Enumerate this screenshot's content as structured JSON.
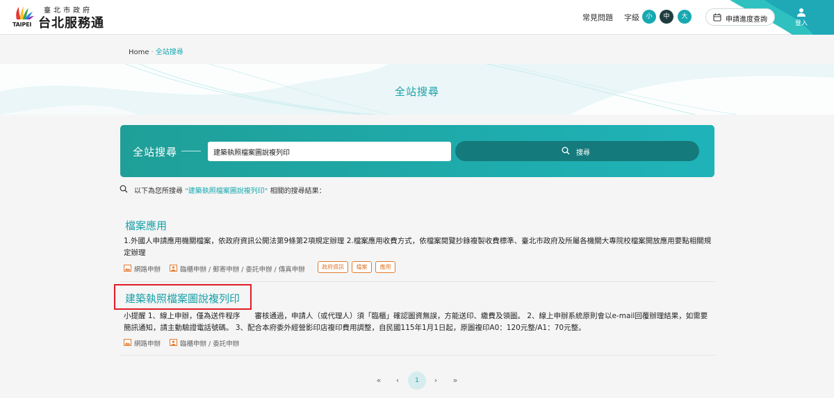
{
  "header": {
    "logo": {
      "gov_label": "臺北市政府",
      "app_name": "台北服務通",
      "city_label": "TAIPEI"
    },
    "faq_label": "常見問題",
    "font_size_label": "字級",
    "font_sizes": [
      "小",
      "中",
      "大"
    ],
    "progress_button_label": "申請進度查詢",
    "login_label": "登入"
  },
  "breadcrumb": {
    "home": "Home",
    "separator": "·",
    "current": "全站搜尋"
  },
  "banner": {
    "title": "全站搜尋"
  },
  "search": {
    "title": "全站搜尋",
    "query": "建築執照檔案圖說複列印",
    "button_label": "搜尋"
  },
  "summary": {
    "prefix": "以下為您所搜尋",
    "query_quoted": "\"建築執照檔案圖說複列印\"",
    "suffix": "相關的搜尋結果："
  },
  "results": [
    {
      "title": "檔案應用",
      "description": "1.外國人申請應用機關檔案，依政府資訊公開法第9條第2項規定辦理 2.檔案應用收費方式，依檔案閱覽抄錄複製收費標準、臺北市政府及所屬各機關大專院校檔案開放應用要點相關規定辦理",
      "online": "網路申辦",
      "counter": "臨櫃申辦 / 郵寄申辦 / 委託申辦 / 傳真申辦",
      "tags": [
        "政府資訊",
        "檔案",
        "應用"
      ]
    },
    {
      "title": "建築執照檔案圖說複列印",
      "description": "小提醒 1、線上申辦，僅為送件程序　　審核通過，申請人（或代理人）須「臨櫃」確認圖資無誤，方能送印、繳費及領圖。 2、線上申辦系統原則會以e-mail回覆辦理結果，如需要簡訊通知，請主動驗證電話號碼。 3、配合本府委外經營影印店複印費用調整，自民國115年1月1日起，原圖複印A0：120元整/A1：70元整。",
      "online": "網路申辦",
      "counter": "臨櫃申辦 / 委託申辦",
      "tags": []
    }
  ],
  "pagination": {
    "first": "«",
    "prev": "‹",
    "pages": [
      "1"
    ],
    "current": "1",
    "next": "›",
    "last": "»"
  },
  "colors": {
    "accent": "#17a9b1",
    "dark_teal": "#157a7b",
    "highlight_box": "#e01b24",
    "tag": "#e07a2e"
  },
  "icons": [
    "taipei-logo-icon",
    "calendar-icon",
    "user-icon",
    "search-icon",
    "image-icon",
    "counter-person-icon"
  ]
}
